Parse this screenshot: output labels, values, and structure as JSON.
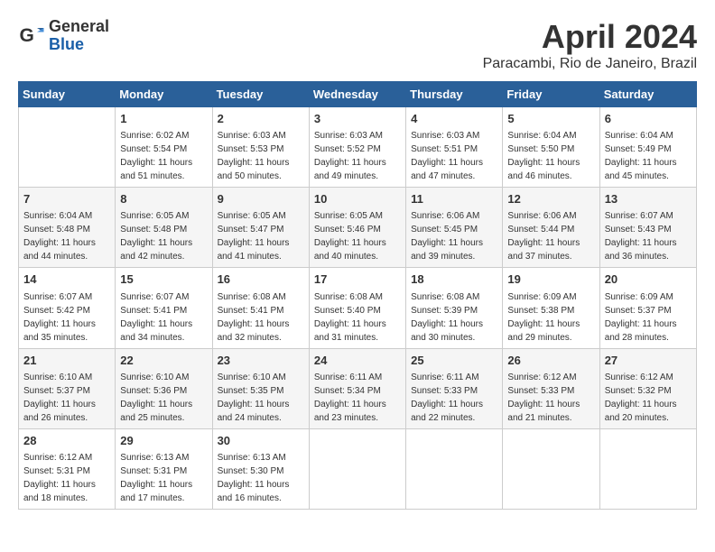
{
  "header": {
    "logo_general": "General",
    "logo_blue": "Blue",
    "month_title": "April 2024",
    "location": "Paracambi, Rio de Janeiro, Brazil"
  },
  "days_of_week": [
    "Sunday",
    "Monday",
    "Tuesday",
    "Wednesday",
    "Thursday",
    "Friday",
    "Saturday"
  ],
  "weeks": [
    [
      {
        "day": "",
        "sunrise": "",
        "sunset": "",
        "daylight": ""
      },
      {
        "day": "1",
        "sunrise": "6:02 AM",
        "sunset": "5:54 PM",
        "daylight": "11 hours and 51 minutes."
      },
      {
        "day": "2",
        "sunrise": "6:03 AM",
        "sunset": "5:53 PM",
        "daylight": "11 hours and 50 minutes."
      },
      {
        "day": "3",
        "sunrise": "6:03 AM",
        "sunset": "5:52 PM",
        "daylight": "11 hours and 49 minutes."
      },
      {
        "day": "4",
        "sunrise": "6:03 AM",
        "sunset": "5:51 PM",
        "daylight": "11 hours and 47 minutes."
      },
      {
        "day": "5",
        "sunrise": "6:04 AM",
        "sunset": "5:50 PM",
        "daylight": "11 hours and 46 minutes."
      },
      {
        "day": "6",
        "sunrise": "6:04 AM",
        "sunset": "5:49 PM",
        "daylight": "11 hours and 45 minutes."
      }
    ],
    [
      {
        "day": "7",
        "sunrise": "6:04 AM",
        "sunset": "5:48 PM",
        "daylight": "11 hours and 44 minutes."
      },
      {
        "day": "8",
        "sunrise": "6:05 AM",
        "sunset": "5:48 PM",
        "daylight": "11 hours and 42 minutes."
      },
      {
        "day": "9",
        "sunrise": "6:05 AM",
        "sunset": "5:47 PM",
        "daylight": "11 hours and 41 minutes."
      },
      {
        "day": "10",
        "sunrise": "6:05 AM",
        "sunset": "5:46 PM",
        "daylight": "11 hours and 40 minutes."
      },
      {
        "day": "11",
        "sunrise": "6:06 AM",
        "sunset": "5:45 PM",
        "daylight": "11 hours and 39 minutes."
      },
      {
        "day": "12",
        "sunrise": "6:06 AM",
        "sunset": "5:44 PM",
        "daylight": "11 hours and 37 minutes."
      },
      {
        "day": "13",
        "sunrise": "6:07 AM",
        "sunset": "5:43 PM",
        "daylight": "11 hours and 36 minutes."
      }
    ],
    [
      {
        "day": "14",
        "sunrise": "6:07 AM",
        "sunset": "5:42 PM",
        "daylight": "11 hours and 35 minutes."
      },
      {
        "day": "15",
        "sunrise": "6:07 AM",
        "sunset": "5:41 PM",
        "daylight": "11 hours and 34 minutes."
      },
      {
        "day": "16",
        "sunrise": "6:08 AM",
        "sunset": "5:41 PM",
        "daylight": "11 hours and 32 minutes."
      },
      {
        "day": "17",
        "sunrise": "6:08 AM",
        "sunset": "5:40 PM",
        "daylight": "11 hours and 31 minutes."
      },
      {
        "day": "18",
        "sunrise": "6:08 AM",
        "sunset": "5:39 PM",
        "daylight": "11 hours and 30 minutes."
      },
      {
        "day": "19",
        "sunrise": "6:09 AM",
        "sunset": "5:38 PM",
        "daylight": "11 hours and 29 minutes."
      },
      {
        "day": "20",
        "sunrise": "6:09 AM",
        "sunset": "5:37 PM",
        "daylight": "11 hours and 28 minutes."
      }
    ],
    [
      {
        "day": "21",
        "sunrise": "6:10 AM",
        "sunset": "5:37 PM",
        "daylight": "11 hours and 26 minutes."
      },
      {
        "day": "22",
        "sunrise": "6:10 AM",
        "sunset": "5:36 PM",
        "daylight": "11 hours and 25 minutes."
      },
      {
        "day": "23",
        "sunrise": "6:10 AM",
        "sunset": "5:35 PM",
        "daylight": "11 hours and 24 minutes."
      },
      {
        "day": "24",
        "sunrise": "6:11 AM",
        "sunset": "5:34 PM",
        "daylight": "11 hours and 23 minutes."
      },
      {
        "day": "25",
        "sunrise": "6:11 AM",
        "sunset": "5:33 PM",
        "daylight": "11 hours and 22 minutes."
      },
      {
        "day": "26",
        "sunrise": "6:12 AM",
        "sunset": "5:33 PM",
        "daylight": "11 hours and 21 minutes."
      },
      {
        "day": "27",
        "sunrise": "6:12 AM",
        "sunset": "5:32 PM",
        "daylight": "11 hours and 20 minutes."
      }
    ],
    [
      {
        "day": "28",
        "sunrise": "6:12 AM",
        "sunset": "5:31 PM",
        "daylight": "11 hours and 18 minutes."
      },
      {
        "day": "29",
        "sunrise": "6:13 AM",
        "sunset": "5:31 PM",
        "daylight": "11 hours and 17 minutes."
      },
      {
        "day": "30",
        "sunrise": "6:13 AM",
        "sunset": "5:30 PM",
        "daylight": "11 hours and 16 minutes."
      },
      {
        "day": "",
        "sunrise": "",
        "sunset": "",
        "daylight": ""
      },
      {
        "day": "",
        "sunrise": "",
        "sunset": "",
        "daylight": ""
      },
      {
        "day": "",
        "sunrise": "",
        "sunset": "",
        "daylight": ""
      },
      {
        "day": "",
        "sunrise": "",
        "sunset": "",
        "daylight": ""
      }
    ]
  ],
  "labels": {
    "sunrise_prefix": "Sunrise: ",
    "sunset_prefix": "Sunset: ",
    "daylight_prefix": "Daylight: "
  }
}
